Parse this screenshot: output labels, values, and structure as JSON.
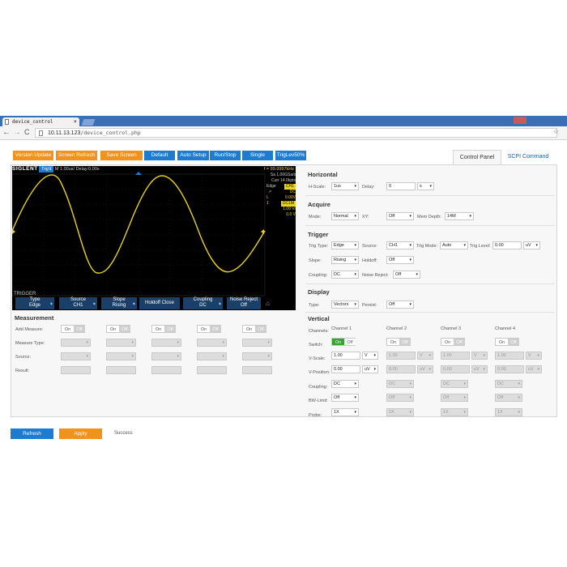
{
  "browser": {
    "tab_title": "device_control",
    "tab_close": "×",
    "url_host": "10.11.13.123",
    "url_path": "/device_control.php",
    "window_controls": "▭ – ▫ ×"
  },
  "toolbar_buttons": [
    {
      "label": "Version Update",
      "color": "#f0921c"
    },
    {
      "label": "Screen Refresh",
      "color": "#f0921c"
    },
    {
      "label": "Save Screen",
      "color": "#f0921c"
    },
    {
      "label": "Default",
      "color": "#1e7cd0"
    },
    {
      "label": "Auto Setup",
      "color": "#1e7cd0"
    },
    {
      "label": "Run/Stop",
      "color": "#1e7cd0"
    },
    {
      "label": "Single",
      "color": "#1e7cd0"
    },
    {
      "label": "TrigLev50%",
      "color": "#1e7cd0"
    }
  ],
  "panel_tabs": {
    "control": "Control Panel",
    "scpi": "SCPI Command"
  },
  "scope": {
    "logo": "SIGLENT",
    "status": "Trig'd",
    "timebase": "M 1.00us/  Delay:0.00s",
    "freq": "f = 99.9997kHz",
    "sample_rate": "Sa 1.00GSa/s",
    "depth": "Curr 14.0kpts",
    "trig_type": "Edge",
    "trig_src": "CH1",
    "slope": "↗",
    "coupling": "DC",
    "level": "0.00V",
    "ch": "1",
    "ch_coupling": "DC1M",
    "volts_div": "1.00 V/",
    "offset": "0.0 V",
    "menu_title": "TRIGGER",
    "softkeys": [
      {
        "top": "Type",
        "bottom": "Edge"
      },
      {
        "top": "Source",
        "bottom": "CH1"
      },
      {
        "top": "Slope",
        "bottom": "Rising"
      },
      {
        "top": "Holdoff Close",
        "bottom": ""
      },
      {
        "top": "Coupling",
        "bottom": "DC"
      },
      {
        "top": "Noise Reject",
        "bottom": "Off"
      }
    ]
  },
  "measurement": {
    "title": "Measurement",
    "labels": [
      "Add Measure:",
      "Measure Type:",
      "Source:",
      "Result:"
    ],
    "on": "On",
    "off": "Off"
  },
  "horizontal": {
    "title": "Horizontal",
    "hscale_label": "H-Scale:",
    "hscale": "1us",
    "delay_label": "Delay:",
    "delay": "0",
    "delay_unit": "s"
  },
  "acquire": {
    "title": "Acquire",
    "mode_label": "Mode:",
    "mode": "Normal",
    "xy_label": "XY:",
    "xy": "Off",
    "mem_label": "Mem Depth:",
    "mem": "14M"
  },
  "trigger": {
    "title": "Trigger",
    "type_label": "Trig Type:",
    "type": "Edge",
    "source_label": "Source:",
    "source": "CH1",
    "mode_label": "Trig Mode:",
    "mode": "Auto",
    "level_label": "Trig Level:",
    "level": "0.00",
    "level_unit": "uV",
    "slope_label": "Slope:",
    "slope": "Rising",
    "holdoff_label": "Holdoff:",
    "holdoff": "Off",
    "coupling_label": "Coupling:",
    "coupling": "DC",
    "noise_label": "Noise Reject:",
    "noise": "Off"
  },
  "display": {
    "title": "Display",
    "type_label": "Type:",
    "type": "Vectors",
    "persist_label": "Persist:",
    "persist": "Off"
  },
  "vertical": {
    "title": "Vertical",
    "channels_label": "Channels:",
    "row_labels": [
      "Switch:",
      "V-Scale:",
      "V-Position:",
      "Coupling:",
      "BW-Limit:",
      "Probe:"
    ],
    "on": "On",
    "off": "Off",
    "channels": [
      {
        "name": "Channel 1",
        "vscale": "1.00",
        "vunit": "V",
        "vpos": "0.00",
        "punit": "uV",
        "coupling": "DC",
        "bw": "Off",
        "probe": "1X"
      },
      {
        "name": "Channel 2",
        "vscale": "1.00",
        "vunit": "V",
        "vpos": "0.00",
        "punit": "uV",
        "coupling": "DC",
        "bw": "Off",
        "probe": "1X"
      },
      {
        "name": "Channel 3",
        "vscale": "1.00",
        "vunit": "V",
        "vpos": "0.00",
        "punit": "uV",
        "coupling": "DC",
        "bw": "Off",
        "probe": "1X"
      },
      {
        "name": "Channel 4",
        "vscale": "1.00",
        "vunit": "V",
        "vpos": "0.00",
        "punit": "uV",
        "coupling": "DC",
        "bw": "Off",
        "probe": "1X"
      }
    ]
  },
  "footer": {
    "refresh": "Refresh",
    "apply": "Apply",
    "status": "Success"
  }
}
